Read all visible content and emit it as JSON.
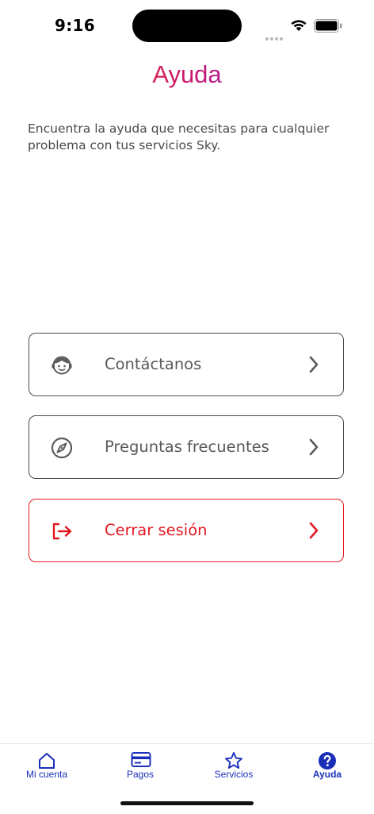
{
  "status_bar": {
    "time": "9:16"
  },
  "header": {
    "title": "Ayuda"
  },
  "intro": {
    "text": "Encuentra la ayuda que necesitas para cualquier problema con tus servicios Sky."
  },
  "menu": [
    {
      "label": "Contáctanos",
      "icon": "headset-agent-icon"
    },
    {
      "label": "Preguntas frecuentes",
      "icon": "compass-icon"
    },
    {
      "label": "Cerrar sesión",
      "icon": "logout-icon"
    }
  ],
  "colors": {
    "accent_blue": "#1a2fb8",
    "danger_red": "#e11a22",
    "text_gray": "#4a4a4a"
  },
  "tab_bar": {
    "items": [
      {
        "label": "Mi cuenta",
        "icon": "home-icon"
      },
      {
        "label": "Pagos",
        "icon": "credit-card-icon"
      },
      {
        "label": "Servicios",
        "icon": "star-icon"
      },
      {
        "label": "Ayuda",
        "icon": "help-circle-icon",
        "active": true
      }
    ]
  }
}
